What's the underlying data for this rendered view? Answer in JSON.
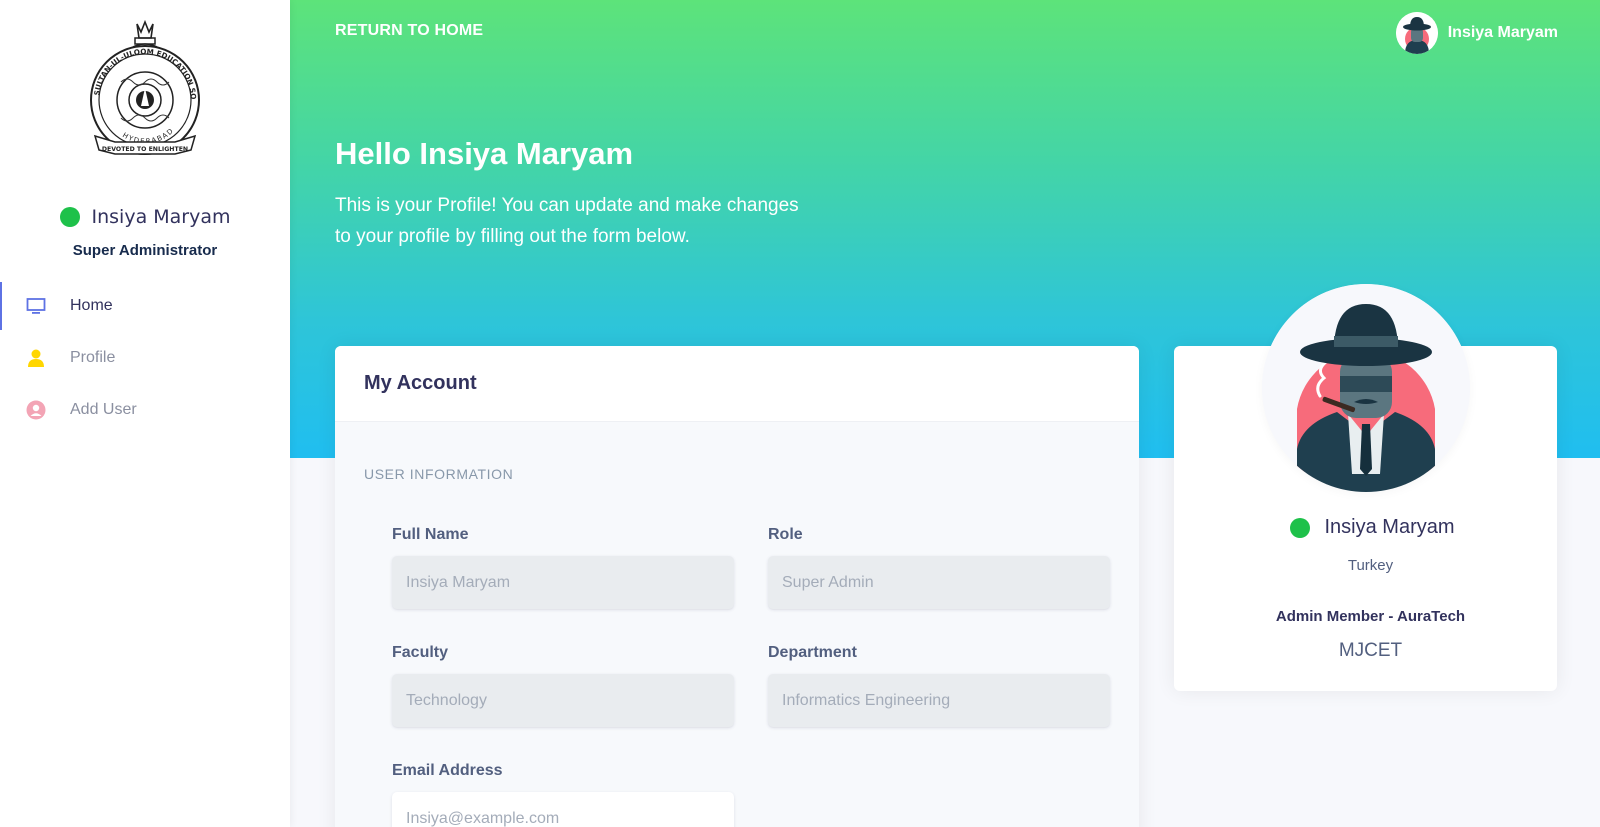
{
  "sidebar": {
    "logo_text": {
      "top": "SULTAN-UL-ULOOM EDUCATION SOCIETY",
      "middle": "HYDERABAD",
      "bottom": "DEVOTED TO ENLIGHTEN"
    },
    "user": {
      "name": "Insiya Maryam",
      "role": "Super Administrator",
      "status_color": "#1ec14a"
    },
    "nav": [
      {
        "label": "Home",
        "icon": "monitor-icon",
        "active": true
      },
      {
        "label": "Profile",
        "icon": "person-icon",
        "active": false
      },
      {
        "label": "Add User",
        "icon": "user-circle-icon",
        "active": false
      }
    ]
  },
  "header": {
    "return_link": "RETURN TO HOME",
    "user_name": "Insiya Maryam",
    "greeting": "Hello Insiya Maryam",
    "description": "This is your Profile! You can update and make changes to your profile by filling out the form below.",
    "gradient": [
      "#5de37a",
      "#20bef0"
    ]
  },
  "account": {
    "title": "My Account",
    "section": "USER INFORMATION",
    "fields": {
      "full_name": {
        "label": "Full Name",
        "placeholder": "Insiya Maryam"
      },
      "role": {
        "label": "Role",
        "placeholder": "Super Admin"
      },
      "faculty": {
        "label": "Faculty",
        "placeholder": "Technology"
      },
      "department": {
        "label": "Department",
        "placeholder": "Informatics Engineering"
      },
      "email": {
        "label": "Email Address",
        "placeholder": "Insiya@example.com"
      }
    }
  },
  "profile_card": {
    "name": "Insiya Maryam",
    "country": "Turkey",
    "organization": "Admin Member - AuraTech",
    "institution": "MJCET",
    "avatar_icon": "spy-avatar-icon"
  }
}
